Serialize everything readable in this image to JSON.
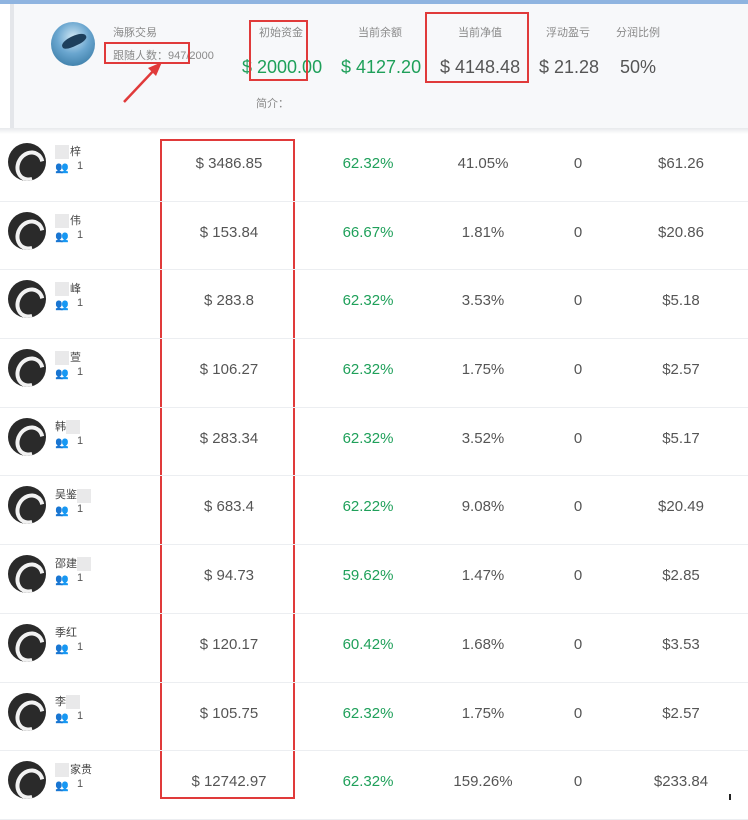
{
  "header": {
    "name": "海豚交易",
    "followers_label": "跟随人数：",
    "followers_value": "947/2000",
    "intro_label": "简介：",
    "stats": [
      {
        "label": "初始资金",
        "value": "$ 2000.00",
        "color": "#1fa05a"
      },
      {
        "label": "当前余额",
        "value": "$ 4127.20",
        "color": "#1fa05a"
      },
      {
        "label": "当前净值",
        "value": "$ 4148.48",
        "color": "#555555"
      },
      {
        "label": "浮动盈亏",
        "value": "$ 21.28",
        "color": "#555555"
      },
      {
        "label": "分润比例",
        "value": "50%",
        "color": "#555555"
      }
    ]
  },
  "rows": [
    {
      "name": "梓",
      "count": "1",
      "equity": "$ 3486.85",
      "ratio": "62.32%",
      "pct": "41.05%",
      "zero": "0",
      "profit": "$61.26"
    },
    {
      "name": "伟",
      "count": "1",
      "equity": "$ 153.84",
      "ratio": "66.67%",
      "pct": "1.81%",
      "zero": "0",
      "profit": "$20.86"
    },
    {
      "name": "峰",
      "count": "1",
      "equity": "$ 283.8",
      "ratio": "62.32%",
      "pct": "3.53%",
      "zero": "0",
      "profit": "$5.18"
    },
    {
      "name": "萱",
      "count": "1",
      "equity": "$ 106.27",
      "ratio": "62.32%",
      "pct": "1.75%",
      "zero": "0",
      "profit": "$2.57"
    },
    {
      "name": "韩",
      "count": "1",
      "equity": "$ 283.34",
      "ratio": "62.32%",
      "pct": "3.52%",
      "zero": "0",
      "profit": "$5.17"
    },
    {
      "name": "吴鉴",
      "count": "1",
      "equity": "$ 683.4",
      "ratio": "62.22%",
      "pct": "9.08%",
      "zero": "0",
      "profit": "$20.49"
    },
    {
      "name": "邵建",
      "count": "1",
      "equity": "$ 94.73",
      "ratio": "59.62%",
      "pct": "1.47%",
      "zero": "0",
      "profit": "$2.85"
    },
    {
      "name": "季红",
      "count": "1",
      "equity": "$ 120.17",
      "ratio": "60.42%",
      "pct": "1.68%",
      "zero": "0",
      "profit": "$3.53"
    },
    {
      "name": "李",
      "count": "1",
      "equity": "$ 105.75",
      "ratio": "62.32%",
      "pct": "1.75%",
      "zero": "0",
      "profit": "$2.57"
    },
    {
      "name": "家贵",
      "count": "1",
      "equity": "$ 12742.97",
      "ratio": "62.32%",
      "pct": "159.26%",
      "zero": "0",
      "profit": "$233.84"
    }
  ],
  "icons": {
    "avatar": "user-avatar-icon",
    "people": "people-icon"
  },
  "colors": {
    "highlight": "#e03a3a",
    "positive": "#1fa05a"
  }
}
